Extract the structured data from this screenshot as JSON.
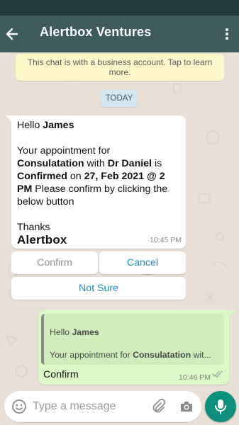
{
  "header": {
    "title": "Alertbox Ventures",
    "menu_icon": "more-vert-icon",
    "back_icon": "arrow-back-icon"
  },
  "notice": {
    "text": "This chat is with a business account. Tap to learn more."
  },
  "date_chip": "TODAY",
  "incoming": {
    "greeting_prefix": "Hello ",
    "greeting_name": "James",
    "line1": "Your appointment for",
    "type": "Consulatation",
    "with_text": " with ",
    "doctor": "Dr Daniel",
    "is_text": " is",
    "status": "Confirmed",
    "on_text": " on ",
    "when": "27, Feb 2021 @ 2 PM",
    "tail_text": " Please confirm by clicking the below button",
    "thanks": "Thanks",
    "signature": "Alertbox",
    "time": "10:45 PM"
  },
  "quick_replies": [
    {
      "label": "Confirm",
      "state": "used"
    },
    {
      "label": "Cancel",
      "state": "active"
    },
    {
      "label": "Not Sure",
      "state": "active"
    }
  ],
  "outgoing": {
    "quote_line1_prefix": "Hello ",
    "quote_line1_name": "James",
    "quote_line2_prefix": "Your appointment for ",
    "quote_line2_bold": "Consulatation",
    "quote_line2_suffix": " wit...",
    "text": "Confirm",
    "time": "10:46 PM",
    "status": "read"
  },
  "input": {
    "placeholder": "Type a message"
  },
  "colors": {
    "header": "#3f5c5c",
    "status_bar": "#233b3a",
    "outgoing_bubble": "#dcf8c6",
    "accent": "#0d8f7e",
    "link": "#1f8dbf"
  }
}
